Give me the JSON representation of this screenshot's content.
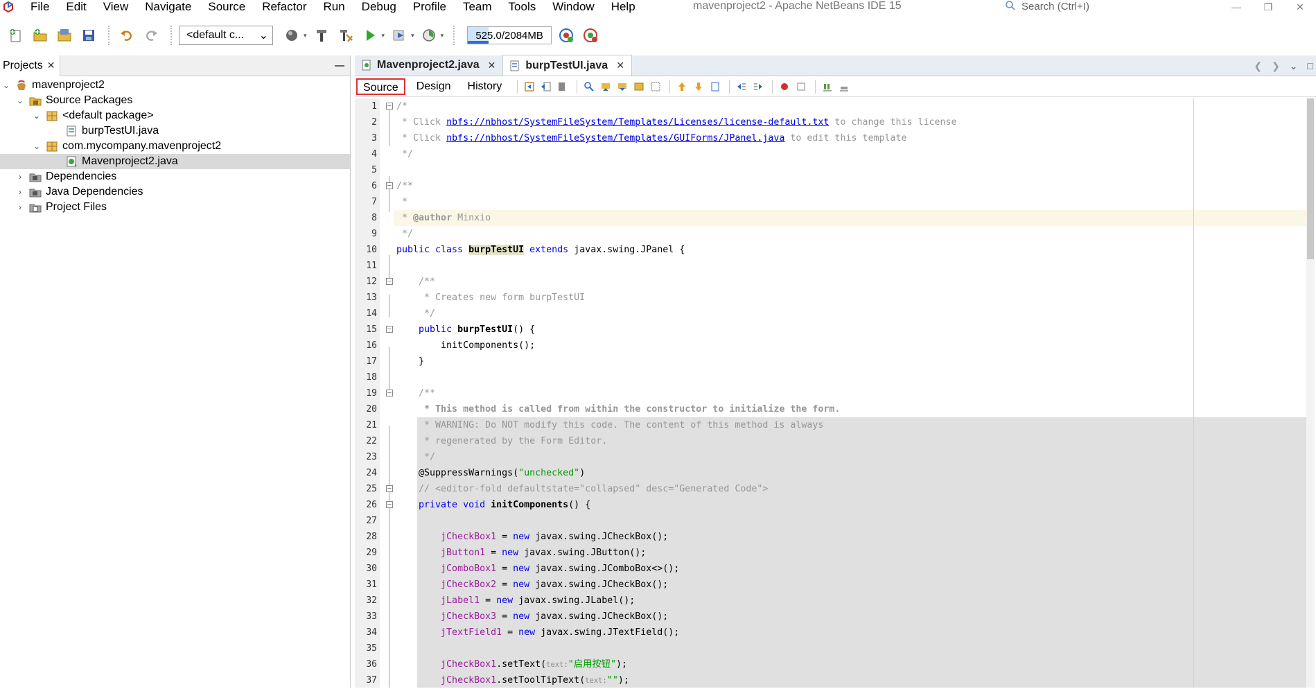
{
  "window": {
    "title": "mavenproject2 - Apache NetBeans IDE 15",
    "search_placeholder": "Search (Ctrl+I)"
  },
  "menu": [
    "File",
    "Edit",
    "View",
    "Navigate",
    "Source",
    "Refactor",
    "Run",
    "Debug",
    "Profile",
    "Team",
    "Tools",
    "Window",
    "Help"
  ],
  "toolbar": {
    "config_combo": "<default c...",
    "memory": "525.0/2084MB",
    "memory_fraction": 0.25
  },
  "projects": {
    "tab_label": "Projects",
    "tree": [
      {
        "label": "mavenproject2",
        "level": 0,
        "expanded": true,
        "icon": "maven-project-icon"
      },
      {
        "label": "Source Packages",
        "level": 1,
        "expanded": true,
        "icon": "source-packages-icon"
      },
      {
        "label": "<default package>",
        "level": 2,
        "expanded": true,
        "icon": "package-icon"
      },
      {
        "label": "burpTestUI.java",
        "level": 3,
        "icon": "java-form-icon"
      },
      {
        "label": "com.mycompany.mavenproject2",
        "level": 2,
        "expanded": true,
        "icon": "package-icon"
      },
      {
        "label": "Mavenproject2.java",
        "level": 3,
        "icon": "java-class-icon",
        "selected": true
      },
      {
        "label": "Dependencies",
        "level": 1,
        "expanded": false,
        "icon": "dependencies-icon"
      },
      {
        "label": "Java Dependencies",
        "level": 1,
        "expanded": false,
        "icon": "java-dependencies-icon"
      },
      {
        "label": "Project Files",
        "level": 1,
        "expanded": false,
        "icon": "project-files-icon"
      }
    ]
  },
  "editor": {
    "tabs": [
      {
        "label": "Mavenproject2.java",
        "active": false
      },
      {
        "label": "burpTestUI.java",
        "active": true
      }
    ],
    "view_tabs": [
      "Source",
      "Design",
      "History"
    ],
    "active_view": "Source"
  },
  "code": {
    "l1": "/*",
    "l2a": " * Click ",
    "l2b": "nbfs://nbhost/SystemFileSystem/Templates/Licenses/license-default.txt",
    "l2c": " to change this license",
    "l3a": " * Click ",
    "l3b": "nbfs://nbhost/SystemFileSystem/Templates/GUIForms/JPanel.java",
    "l3c": " to edit this template",
    "l4": " */",
    "l6": "/**",
    "l7": " *",
    "l8a": " * ",
    "l8b": "@author",
    "l8c": " Minxio",
    "l9": " */",
    "l10a": "public class ",
    "l10b": "burpTestUI",
    "l10c": " extends ",
    "l10d": "javax.swing.JPanel {",
    "l12": "    /**",
    "l13": "     * Creates new form burpTestUI",
    "l14": "     */",
    "l15a": "    public ",
    "l15b": "burpTestUI",
    "l15c": "() {",
    "l16": "        initComponents();",
    "l17": "    }",
    "l19": "    /**",
    "l20": "     * This method is called from within the constructor to initialize the form.",
    "l21": "     * WARNING: Do NOT modify this code. The content of this method is always",
    "l22": "     * regenerated by the Form Editor.",
    "l23": "     */",
    "l24a": "    @SuppressWarnings(",
    "l24b": "\"unchecked\"",
    "l24c": ")",
    "l25": "    // <editor-fold defaultstate=\"collapsed\" desc=\"Generated Code\">",
    "l26a": "    private void ",
    "l26b": "initComponents",
    "l26c": "() {",
    "l28a": "jCheckBox1",
    "l28b": " = ",
    "l28c": "new",
    "l28d": " javax.swing.JCheckBox();",
    "l29a": "jButton1",
    "l29d": " javax.swing.JButton();",
    "l30a": "jComboBox1",
    "l30d": " javax.swing.JComboBox<>();",
    "l31a": "jCheckBox2",
    "l31d": " javax.swing.JCheckBox();",
    "l32a": "jLabel1",
    "l32d": " javax.swing.JLabel();",
    "l33a": "jCheckBox3",
    "l33d": " javax.swing.JCheckBox();",
    "l34a": "jTextField1",
    "l34d": " javax.swing.JTextField();",
    "l36a": "jCheckBox1",
    "l36b": ".setText(",
    "l36c": "text:",
    "l36d": "\"启用按钮\"",
    "l36e": ");",
    "l37a": "jCheckBox1",
    "l37b": ".setToolTipText(",
    "l37c": "text:",
    "l37d": "\"\"",
    "l37e": ");",
    "new_kw": "new",
    "eq": " = "
  },
  "line_numbers": [
    "1",
    "2",
    "3",
    "4",
    "5",
    "6",
    "7",
    "8",
    "9",
    "10",
    "11",
    "12",
    "13",
    "14",
    "15",
    "16",
    "17",
    "18",
    "19",
    "20",
    "21",
    "22",
    "23",
    "24",
    "25",
    "26",
    "27",
    "28",
    "29",
    "30",
    "31",
    "32",
    "33",
    "34",
    "35",
    "36",
    "37"
  ]
}
